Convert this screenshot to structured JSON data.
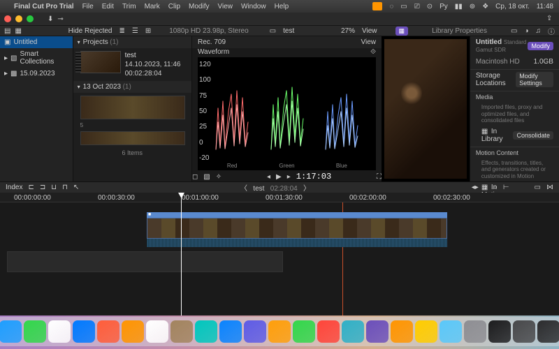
{
  "menubar": {
    "apple": "",
    "app": "Final Cut Pro Trial",
    "items": [
      "File",
      "Edit",
      "Trim",
      "Mark",
      "Clip",
      "Modify",
      "View",
      "Window",
      "Help"
    ],
    "status": {
      "date": "Ср, 18 окт.",
      "time": "11:48"
    }
  },
  "toolbar": {
    "hide_rejected": "Hide Rejected",
    "format": "1080p HD 23.98p, Stereo",
    "project": "test",
    "zoom": "27%",
    "view": "View",
    "lib_props": "Library Properties"
  },
  "sidebar": {
    "items": [
      {
        "label": "Untitled",
        "selected": true,
        "icon": "library"
      },
      {
        "label": "Smart Collections",
        "selected": false,
        "icon": "folder"
      },
      {
        "label": "15.09.2023",
        "selected": false,
        "icon": "event"
      }
    ]
  },
  "browser": {
    "projects_hdr": "Projects",
    "projects_count": "(1)",
    "proj": {
      "name": "test",
      "date": "14.10.2023, 11:46",
      "dur": "00:02:28:04"
    },
    "event_hdr": "13 Oct 2023",
    "event_count": "(1)",
    "clip_idx": "5",
    "footer": "6 Items"
  },
  "scope": {
    "title": "Rec. 709",
    "view": "View",
    "type": "Waveform",
    "ticks": [
      "120",
      "100",
      "75",
      "50",
      "25",
      "0",
      "-20"
    ],
    "channels": [
      "Red",
      "Green",
      "Blue"
    ]
  },
  "transport": {
    "tc": "1:17:03"
  },
  "inspector": {
    "name": "Untitled",
    "kind": "Standard Gamut SDR",
    "modify": "Modify",
    "drive": "Macintosh HD",
    "size": "1.0GB",
    "storage_hdr": "Storage Locations",
    "modify_settings": "Modify Settings",
    "media_hdr": "Media",
    "media_sub": "Imported files, proxy and optimized files, and consolidated files",
    "in_library": "In Library",
    "consolidate": "Consolidate",
    "motion_hdr": "Motion Content",
    "motion_sub": "Effects, transitions, titles, and generators created or customized in Motion",
    "in_motion": "In Motion Templates folder"
  },
  "timeline_bar": {
    "index": "Index",
    "name": "test",
    "dur": "02:28:04"
  },
  "ruler": [
    "00:00:00:00",
    "00:00:30:00",
    "00:01:00:00",
    "00:01:30:00",
    "00:02:00:00",
    "00:02:30:00"
  ],
  "dock_colors": [
    "#1e7fff",
    "#1e9fff",
    "#32d74b",
    "#ffffff",
    "#007aff",
    "#ff5e3a",
    "#ff9500",
    "#ffffff",
    "#a2845e",
    "#00c7be",
    "#0a84ff",
    "#5e5ce6",
    "#ff9f0a",
    "#32d74b",
    "#ff453a",
    "#30b0c7",
    "#6b4fbb",
    "#ff9500",
    "#ffcc00",
    "#5ac8fa",
    "#8e8e93",
    "#1c1c1e",
    "#48484a",
    "#2c2c2e",
    "#0a84ff"
  ]
}
